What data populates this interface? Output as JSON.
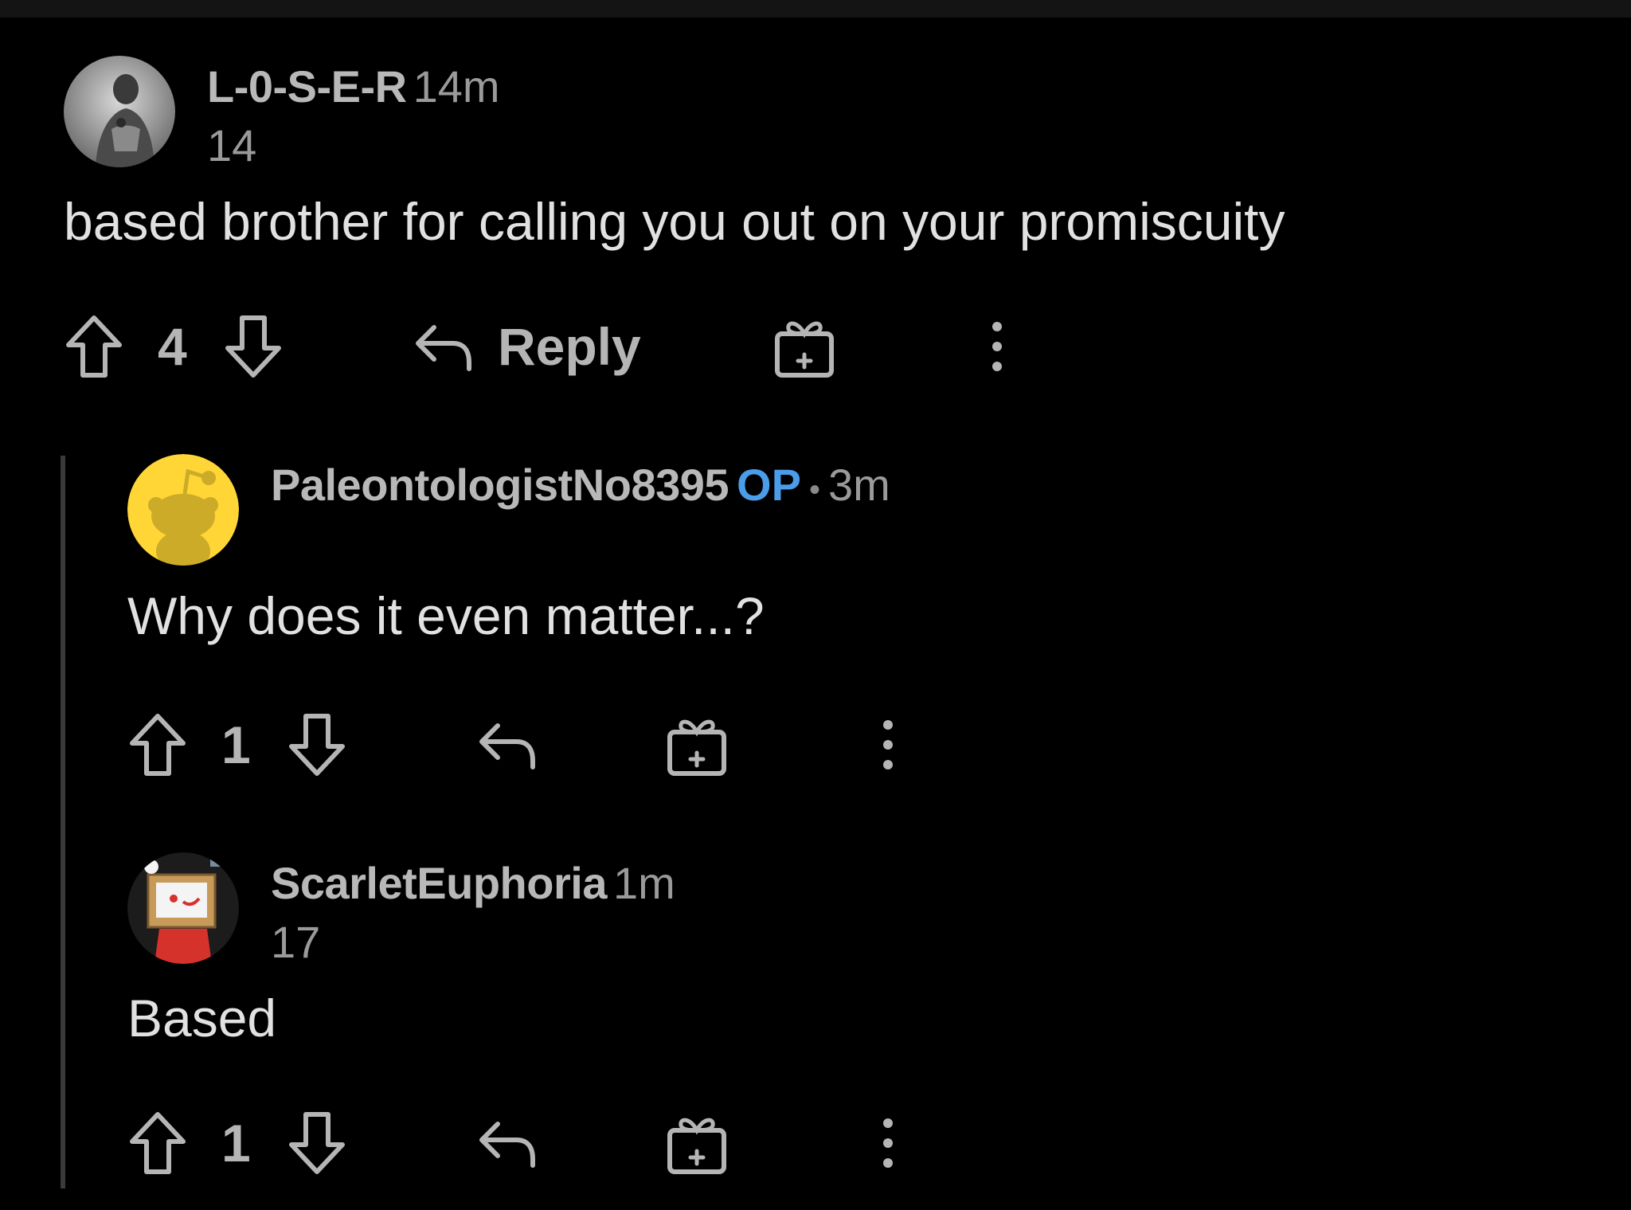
{
  "comments": [
    {
      "username": "L-0-S-E-R",
      "time": "14m",
      "karma": "14",
      "op": "",
      "body": "based brother for calling you out on your promiscuity",
      "votes": "4",
      "reply_label": "Reply"
    },
    {
      "username": "PaleontologistNo8395",
      "time": "3m",
      "karma": "",
      "op": "OP",
      "separator": "•",
      "body": "Why does it even matter...?",
      "votes": "1"
    },
    {
      "username": "ScarletEuphoria",
      "time": "1m",
      "karma": "17",
      "op": "",
      "body": "Based",
      "votes": "1"
    }
  ],
  "icons": [
    "upvote-icon",
    "downvote-icon",
    "reply-icon",
    "award-icon",
    "more-options-icon"
  ],
  "colors": {
    "background": "#000000",
    "op_tag": "#4a9de8",
    "text": "#e1e1e1",
    "muted": "#9a9a9a"
  }
}
